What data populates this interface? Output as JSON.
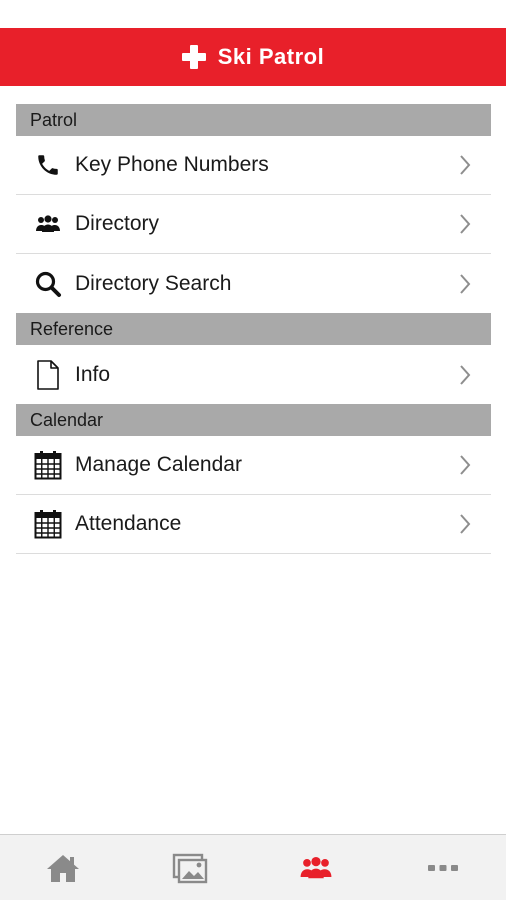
{
  "header": {
    "title": "Ski Patrol",
    "icon": "red-cross-icon",
    "background_color": "#e8202a"
  },
  "sections": [
    {
      "title": "Patrol",
      "items": [
        {
          "label": "Key Phone Numbers",
          "icon": "phone-icon"
        },
        {
          "label": "Directory",
          "icon": "people-icon"
        },
        {
          "label": "Directory Search",
          "icon": "search-icon"
        }
      ]
    },
    {
      "title": "Reference",
      "items": [
        {
          "label": "Info",
          "icon": "document-icon"
        }
      ]
    },
    {
      "title": "Calendar",
      "items": [
        {
          "label": "Manage Calendar",
          "icon": "calendar-icon"
        },
        {
          "label": "Attendance",
          "icon": "calendar-icon"
        }
      ]
    }
  ],
  "tab_bar": {
    "tabs": [
      {
        "name": "home",
        "icon": "home-icon",
        "active": false
      },
      {
        "name": "gallery",
        "icon": "photos-icon",
        "active": false
      },
      {
        "name": "patrol",
        "icon": "people-icon",
        "active": true
      },
      {
        "name": "more",
        "icon": "more-icon",
        "active": false
      }
    ],
    "active_color": "#e8202a",
    "inactive_color": "#8a8a8a"
  }
}
